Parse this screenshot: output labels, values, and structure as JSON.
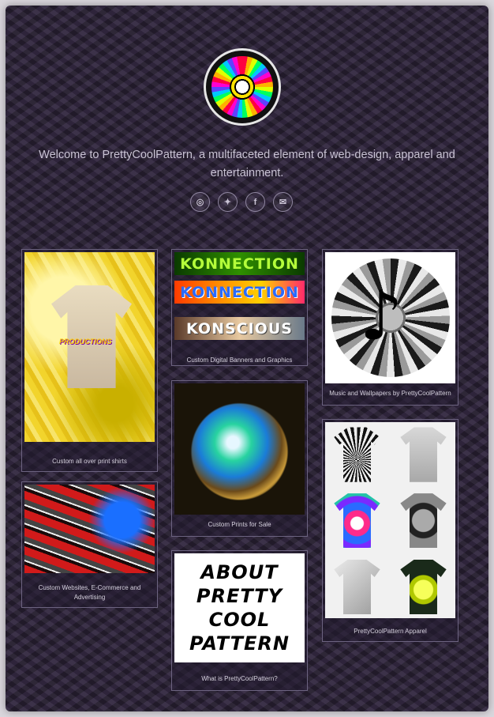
{
  "header": {
    "logo_icon": "mandala-logo",
    "welcome": "Welcome to PrettyCoolPattern, a multifaceted element of web-design, apparel and entertainment."
  },
  "social": [
    {
      "icon": "instagram-icon",
      "glyph": "◎"
    },
    {
      "icon": "twitter-icon",
      "glyph": "✦"
    },
    {
      "icon": "facebook-icon",
      "glyph": "f"
    },
    {
      "icon": "email-icon",
      "glyph": "✉"
    }
  ],
  "cards": {
    "shirts": {
      "caption": "Custom all over print shirts",
      "image_text": "PRODUCTIONS"
    },
    "banners": {
      "caption": "Custom Digital Banners and Graphics",
      "b1": "KONNECTION",
      "b2": "KONNECTION",
      "b3": "KONSCIOUS"
    },
    "music": {
      "caption": "Music and Wallpapers by PrettyCoolPattern",
      "note": "♪"
    },
    "prints": {
      "caption": "Custom Prints for Sale"
    },
    "websites": {
      "caption": "Custom Websites, E-Commerce and Advertising"
    },
    "about": {
      "caption": "What is PrettyCoolPattern?",
      "image_text": "ABOUT PRETTY COOL PATTERN"
    },
    "apparel": {
      "caption": "PrettyCoolPattern Apparel"
    }
  }
}
